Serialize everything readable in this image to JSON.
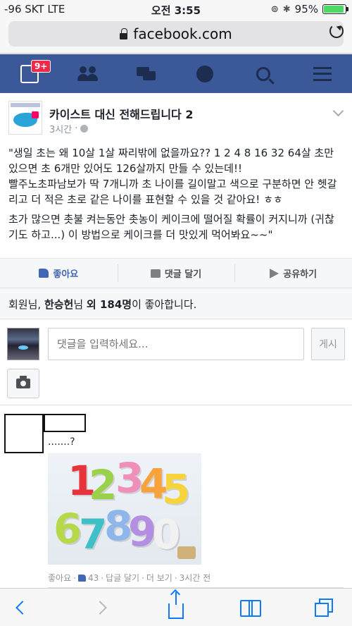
{
  "status_bar": {
    "carrier": "-96 SKT  LTE",
    "time": "오전 3:55",
    "battery": "95%",
    "battery_level": 0.95
  },
  "browser": {
    "url": "facebook.com"
  },
  "fb_nav": {
    "notification_badge": "9+",
    "icons": [
      "news-feed-icon",
      "friends-icon",
      "messages-icon",
      "globe-icon",
      "search-icon",
      "menu-icon"
    ]
  },
  "post": {
    "page_name": "카이스트 대신 전해드립니다 2",
    "time": "3시간",
    "paragraphs": [
      "\"생일 초는 왜 10살 1살 짜리밖에 없을까요?? 1 2 4 8 16 32 64살 초만 있으면 초 6개만 있어도 126살까지 만들 수 있는데!!",
      "빨주노초파남보가 딱 7개니까 초 나이를 길이말고 색으로 구분하면 안 헷갈리고 더 적은 초로 같은 나이를 표현할 수 있을 것 같아요! ㅎㅎ",
      "초가 많으면 촛불 켜는동안 촛농이 케이크에 떨어질 확률이 커지니까 (귀찮기도 하고...) 이 방법으로 케이크를 더 맛있게 먹어봐요~~\""
    ],
    "actions": {
      "like": "좋아요",
      "comment": "댓글 달기",
      "share": "공유하기"
    },
    "likes_summary": {
      "prefix": "회원님, ",
      "name": "한승헌",
      "mid": "님 ",
      "others": "외 184명",
      "suffix": "이 좋아합니다."
    }
  },
  "composer": {
    "placeholder": "댓글을 입력하세요...",
    "post_label": "게시"
  },
  "comment": {
    "text": ".......?",
    "image_digits": [
      "1",
      "2",
      "3",
      "4",
      "5",
      "6",
      "7",
      "8",
      "9",
      "0"
    ],
    "meta": {
      "like": "좋아요",
      "like_count": "43",
      "reply": "답글 달기",
      "more": "더 보기",
      "time": "3시간 전"
    }
  },
  "colors": {
    "fb_blue": "#3b5998",
    "ios_blue": "#0a7aff",
    "badge_red": "#f02849"
  }
}
